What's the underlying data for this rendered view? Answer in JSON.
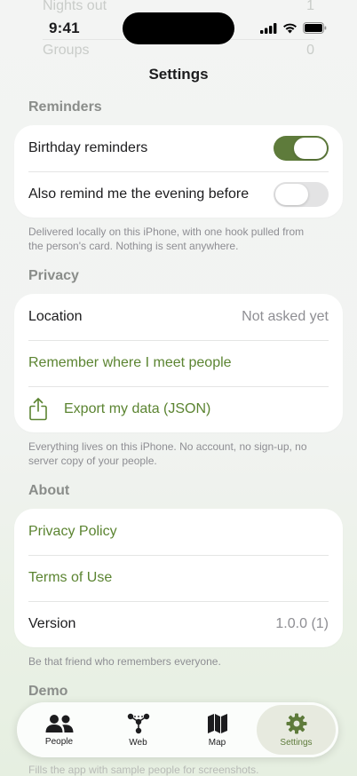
{
  "ghost": {
    "rows": [
      {
        "label": "Nights out",
        "value": "1"
      },
      {
        "label": "Groups",
        "value": "0"
      }
    ]
  },
  "status_bar": {
    "time": "9:41"
  },
  "nav": {
    "title": "Settings"
  },
  "reminders": {
    "header": "Reminders",
    "birthday_label": "Birthday reminders",
    "birthday_on": true,
    "evening_label": "Also remind me the evening before",
    "evening_on": false,
    "footer": "Delivered locally on this iPhone, with one hook pulled from the person's card. Nothing is sent anywhere."
  },
  "privacy": {
    "header": "Privacy",
    "location_label": "Location",
    "location_value": "Not asked yet",
    "remember_link": "Remember where I meet people",
    "export_link": "Export my data (JSON)",
    "footer": "Everything lives on this iPhone. No account, no sign-up, no server copy of your people."
  },
  "about": {
    "header": "About",
    "privacy_policy": "Privacy Policy",
    "terms": "Terms of Use",
    "version_label": "Version",
    "version_value": "1.0.0 (1)",
    "footer": "Be that friend who remembers everyone."
  },
  "demo": {
    "header": "Demo",
    "footer": "Fills the app with sample people for screenshots."
  },
  "tabs": [
    {
      "label": "People",
      "icon": "people-icon"
    },
    {
      "label": "Web",
      "icon": "web-icon"
    },
    {
      "label": "Map",
      "icon": "map-icon"
    },
    {
      "label": "Settings",
      "icon": "gear-icon",
      "active": true
    }
  ],
  "colors": {
    "accent": "#5e7b3b",
    "link": "#5b8431"
  }
}
